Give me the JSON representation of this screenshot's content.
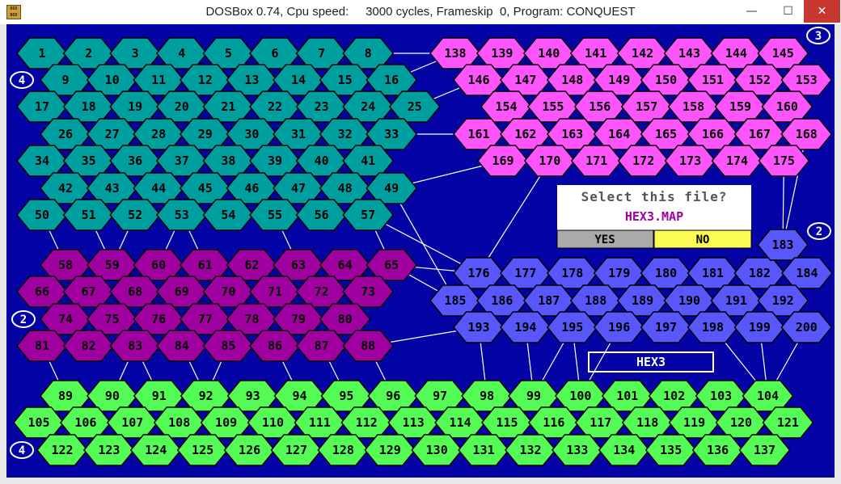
{
  "window": {
    "title": "DOSBox 0.74, Cpu speed:     3000 cycles, Frameskip  0, Program: CONQUEST",
    "app_icon_text": "DOS BOX",
    "minimize": "—",
    "maximize": "☐",
    "close": "✕"
  },
  "colors": {
    "background": "#0303a6",
    "region_1": "#009f9f",
    "region_2": "#fb55fb",
    "region_3": "#9f009f",
    "region_4": "#5757fb",
    "region_5": "#55fb55",
    "dialog_no": "#fbfb55"
  },
  "map": {
    "hex_numbers": [
      "1",
      "2",
      "3",
      "4",
      "5",
      "6",
      "7",
      "8",
      "9",
      "10",
      "11",
      "12",
      "13",
      "14",
      "15",
      "16",
      "17",
      "18",
      "19",
      "20",
      "21",
      "22",
      "23",
      "24",
      "25",
      "26",
      "27",
      "28",
      "29",
      "30",
      "31",
      "32",
      "33",
      "34",
      "35",
      "36",
      "37",
      "38",
      "39",
      "40",
      "41",
      "42",
      "43",
      "44",
      "45",
      "46",
      "47",
      "48",
      "49",
      "50",
      "51",
      "52",
      "53",
      "54",
      "55",
      "56",
      "57",
      "58",
      "59",
      "60",
      "61",
      "62",
      "63",
      "64",
      "65",
      "66",
      "67",
      "68",
      "69",
      "70",
      "71",
      "72",
      "73",
      "74",
      "75",
      "76",
      "77",
      "78",
      "79",
      "80",
      "81",
      "82",
      "83",
      "84",
      "85",
      "86",
      "87",
      "88",
      "89",
      "90",
      "91",
      "92",
      "93",
      "94",
      "95",
      "96",
      "97",
      "98",
      "99",
      "100",
      "101",
      "102",
      "103",
      "104",
      "105",
      "106",
      "107",
      "108",
      "109",
      "110",
      "111",
      "112",
      "113",
      "114",
      "115",
      "116",
      "117",
      "118",
      "119",
      "120",
      "121",
      "122",
      "123",
      "124",
      "125",
      "126",
      "127",
      "128",
      "129",
      "130",
      "131",
      "132",
      "133",
      "134",
      "135",
      "136",
      "137",
      "138",
      "139",
      "140",
      "141",
      "142",
      "143",
      "144",
      "145",
      "146",
      "147",
      "148",
      "149",
      "150",
      "151",
      "152",
      "153",
      "154",
      "155",
      "156",
      "157",
      "158",
      "159",
      "160",
      "161",
      "162",
      "163",
      "164",
      "165",
      "166",
      "167",
      "168",
      "169",
      "170",
      "171",
      "172",
      "173",
      "174",
      "175",
      "176",
      "177",
      "178",
      "179",
      "180",
      "181",
      "182",
      "183",
      "184",
      "185",
      "186",
      "187",
      "188",
      "189",
      "190",
      "191",
      "192",
      "193",
      "194",
      "195",
      "196",
      "197",
      "198",
      "199",
      "200"
    ],
    "region_labels": {
      "region_1": "4",
      "region_2": "3",
      "region_3": "2",
      "region_4": "2",
      "region_5": "4"
    },
    "map_name": "HEX3"
  },
  "dialog": {
    "question": "Select this file?",
    "filename": "HEX3.MAP",
    "yes_label": "YES",
    "no_label": "NO"
  }
}
